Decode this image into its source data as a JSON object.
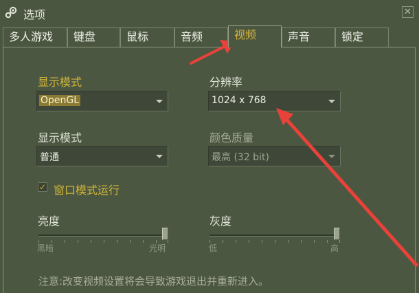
{
  "window": {
    "title": "选项",
    "close_glyph": "✕"
  },
  "tabs": [
    {
      "label": "多人游戏"
    },
    {
      "label": "键盘"
    },
    {
      "label": "鼠标"
    },
    {
      "label": "音频"
    },
    {
      "label": "视频",
      "active": true
    },
    {
      "label": "声音"
    },
    {
      "label": "锁定"
    }
  ],
  "video": {
    "display_mode_label": "显示模式",
    "display_mode_value": "OpenGL",
    "resolution_label": "分辨率",
    "resolution_value": "1024 x 768",
    "display_mode2_label": "显示模式",
    "display_mode2_value": "普通",
    "color_quality_label": "颜色质量",
    "color_quality_value": "最高 (32 bit)",
    "windowed_label": "窗口模式运行",
    "windowed_checked": true,
    "brightness_label": "亮度",
    "brightness_min": "黑暗",
    "brightness_max": "光明",
    "brightness_value": 1.0,
    "gamma_label": "灰度",
    "gamma_min": "低",
    "gamma_max": "高",
    "gamma_value": 1.0,
    "note": "注意:改变视频设置将会导致游戏退出并重新进入。"
  },
  "colors": {
    "background": "#4b5641",
    "active_tab_text": "#d6b43a",
    "annotation_arrow": "#e8423a"
  },
  "icons": {
    "app": "steam-icon",
    "close": "close-icon",
    "dropdown": "chevron-down-icon",
    "check": "checkmark-icon"
  }
}
